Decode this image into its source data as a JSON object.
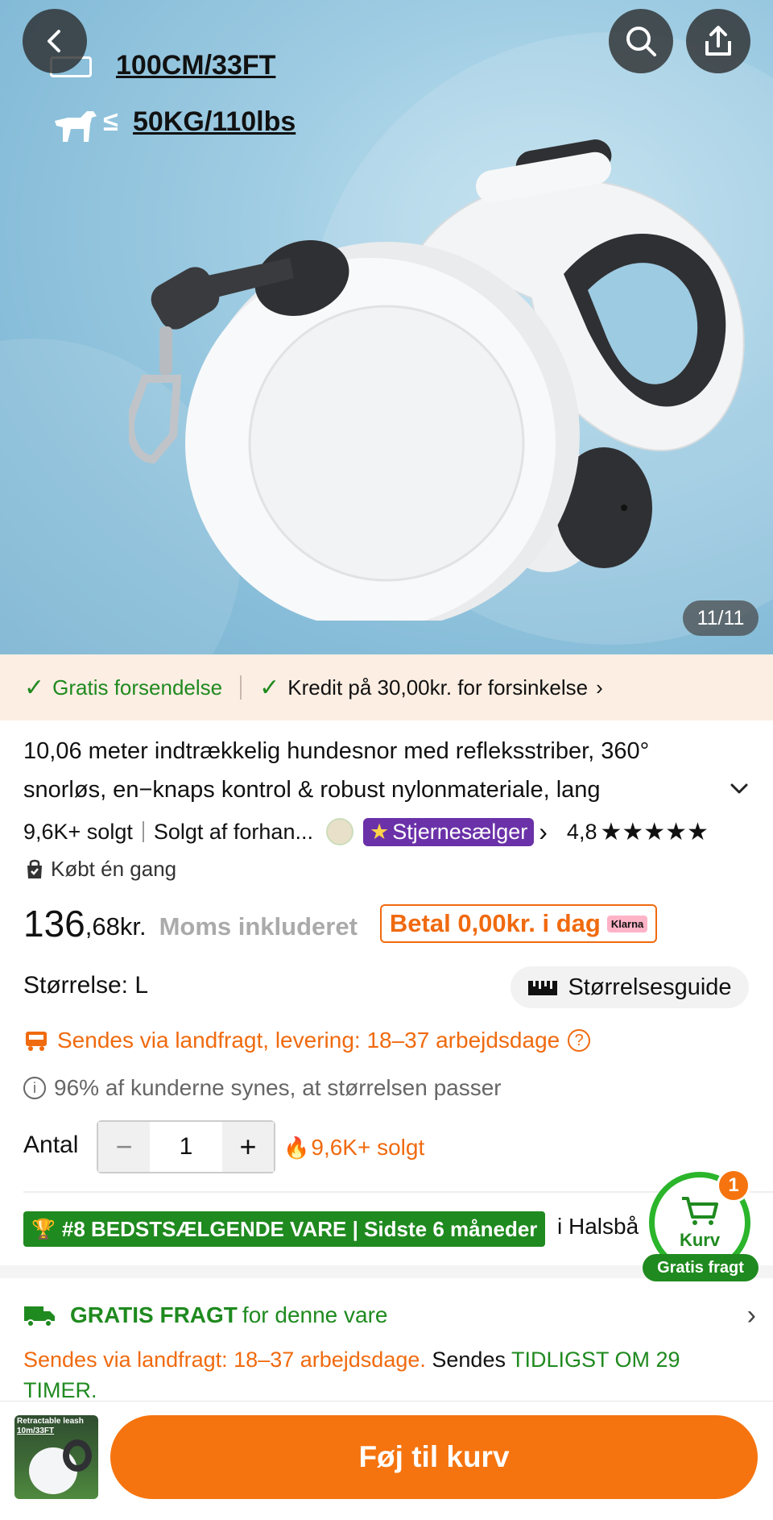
{
  "hero": {
    "spec_length": "100CM/33FT",
    "spec_weight_prefix": "≤",
    "spec_weight": "50KG/110lbs",
    "image_counter": "11/11"
  },
  "benefits": {
    "free_shipping": "Gratis forsendelse",
    "credit": "Kredit på 30,00kr. for forsinkelse"
  },
  "product": {
    "title_line1": "10,06 meter indtrækkelig hundesnor med refleksstriber, 360°",
    "title_line2": "snorløs, en−knaps kontrol & robust nylonmateriale, lang",
    "sold": "9,6K+ solgt",
    "seller": "Solgt af forhan...",
    "star_seller": "Stjernesælger",
    "rating": "4,8",
    "stars": "★★★★★",
    "bought_once": "Købt én gang"
  },
  "price": {
    "main": "136",
    "decimals": ",68kr.",
    "vat": "Moms inkluderet",
    "pay_today": "Betal 0,00kr. i dag",
    "klarna": "Klarna"
  },
  "size": {
    "label": "Størrelse: L",
    "guide": "Størrelsesguide"
  },
  "shipping": {
    "ground": "Sendes via landfragt, levering: 18–37 arbejdsdage",
    "fit_note": "96% af kunderne synes, at størrelsen passer"
  },
  "quantity": {
    "label": "Antal",
    "value": "1",
    "minus": "−",
    "plus": "+",
    "sold": "9,6K+ solgt"
  },
  "bestseller": {
    "badge": "#8 BEDSTSÆLGENDE VARE | Sidste 6 måneder",
    "category": "i Halsbå"
  },
  "cart": {
    "count": "1",
    "label": "Kurv",
    "free_shipping": "Gratis fragt"
  },
  "free_freight": {
    "title": "GRATIS FRAGT",
    "suffix": "for denne vare",
    "line_orange": "Sendes via landfragt: 18–37 arbejdsdage.",
    "line_black": "Sendes",
    "line_green": "TIDLIGST OM 29",
    "line_green2": "TIMER."
  },
  "bottom": {
    "thumb_caption1": "Retractable leash",
    "thumb_caption2": "10m/33FT",
    "add_to_cart": "Føj til kurv"
  },
  "colors": {
    "accent_orange": "#f5740f",
    "green": "#1f8a1f",
    "purple": "#6b31a8"
  }
}
